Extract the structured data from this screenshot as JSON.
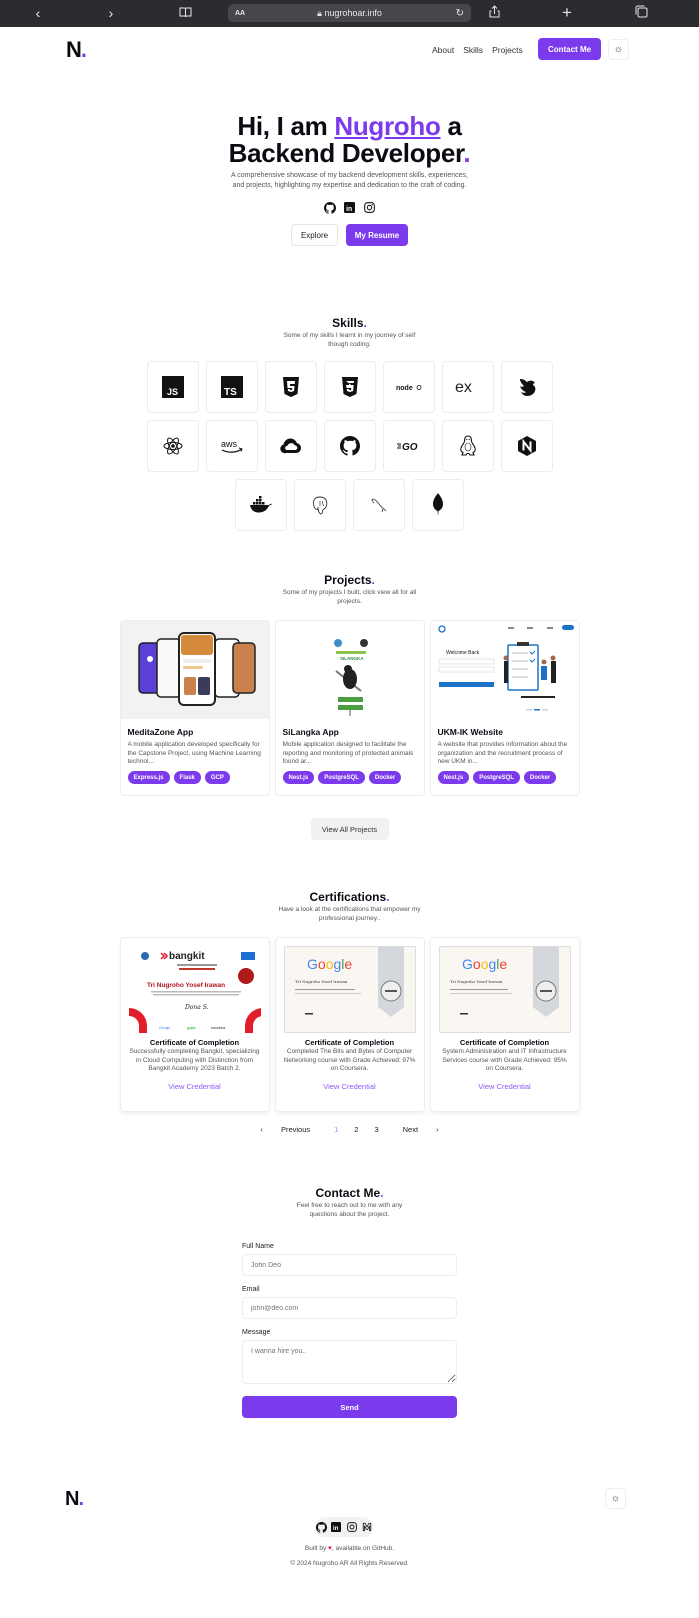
{
  "browser": {
    "url": "nugrohoar.info",
    "aa_label": "AA"
  },
  "nav": {
    "logo": "N",
    "logo_dot": ".",
    "links": [
      "About",
      "Skills",
      "Projects"
    ],
    "contact_label": "Contact Me"
  },
  "hero": {
    "greeting": "Hi, I am ",
    "name": "Nugroho",
    "after_name": " a",
    "role": "Backend Developer",
    "dot": ".",
    "description": "A comprehensive showcase of my backend development skills, experiences, and projects, highlighting my expertise and dedication to the craft of coding.",
    "socials": [
      "github-icon",
      "linkedin-icon",
      "instagram-icon"
    ],
    "explore_label": "Explore",
    "resume_label": "My Resume"
  },
  "skills": {
    "title": "Skills",
    "subtitle": "Some of my skills I learnt in my journey of self though coding.",
    "items": [
      "JavaScript",
      "TypeScript",
      "HTML5",
      "CSS3",
      "Node.js",
      "Express",
      "NestJS",
      "React",
      "AWS",
      "Google Cloud",
      "GitHub",
      "Go",
      "Linux",
      "Nginx",
      "Docker",
      "PostgreSQL",
      "MySQL",
      "MongoDB"
    ]
  },
  "projects": {
    "title": "Projects",
    "subtitle": "Some of my projects I built, click view all for all projects.",
    "items": [
      {
        "title": "MeditaZone App",
        "description": "A mobile application developed specifically for the Capstone Project, using Machine Learning technol...",
        "tags": [
          "Express.js",
          "Flask",
          "GCP"
        ]
      },
      {
        "title": "SiLangka App",
        "description": "Mobile application designed to facilitate the reporting and monitoring of protected animals found ar...",
        "tags": [
          "Nest.js",
          "PostgreSQL",
          "Docker"
        ]
      },
      {
        "title": "UKM-IK Website",
        "description": "A website that provides information about the organization and the recruitment process of new UKM in...",
        "tags": [
          "Nest.js",
          "PostgreSQL",
          "Docker"
        ]
      }
    ],
    "view_all_label": "View All Projects",
    "image_texts": {
      "silangka_title": "SILANGKA",
      "ukm_welcome": "Welcome Back"
    }
  },
  "certifications": {
    "title": "Certifications",
    "subtitle": "Have a look at the certifications that empower my professional journey..",
    "items": [
      {
        "title": "Certificate of Completion",
        "description": "Successfully completing Bangkit, specializing in Cloud Computing with Distinction from Bangkit Academy 2023 Batch 2.",
        "link": "View Credential",
        "issuer": "bangkit",
        "recipient": "Tri Nugroho Yosef Irawan"
      },
      {
        "title": "Certificate of Completion",
        "description": "Completed The Bits and Bytes of Computer Networking course with Grade Achieved: 97% on Coursera.",
        "link": "View Credential",
        "issuer": "Google"
      },
      {
        "title": "Certificate of Completion",
        "description": "System Administration and IT Infrastructure Services course with Grade Achieved: 95% on Coursera.",
        "link": "View Credential",
        "issuer": "Google"
      }
    ],
    "pagination": {
      "previous": "Previous",
      "pages": [
        "1",
        "2",
        "3"
      ],
      "current": "1",
      "next": "Next"
    }
  },
  "contact": {
    "title": "Contact Me",
    "subtitle": "Feel free to reach out to me with any questions about the project.",
    "fields": {
      "name_label": "Full Name",
      "name_placeholder": "John Deo",
      "email_label": "Email",
      "email_placeholder": "john@deo.com",
      "message_label": "Message",
      "message_placeholder": "I wanna hire you.."
    },
    "send_label": "Send"
  },
  "footer": {
    "logo": "N",
    "built_prefix": "Built by ",
    "built_suffix": ", available on GitHub.",
    "copyright": "© 2024 Nugroho AR All Rights Reserved."
  },
  "colors": {
    "accent": "#7c3aed",
    "link": "#8b5cf6",
    "heart": "#e11d48"
  }
}
